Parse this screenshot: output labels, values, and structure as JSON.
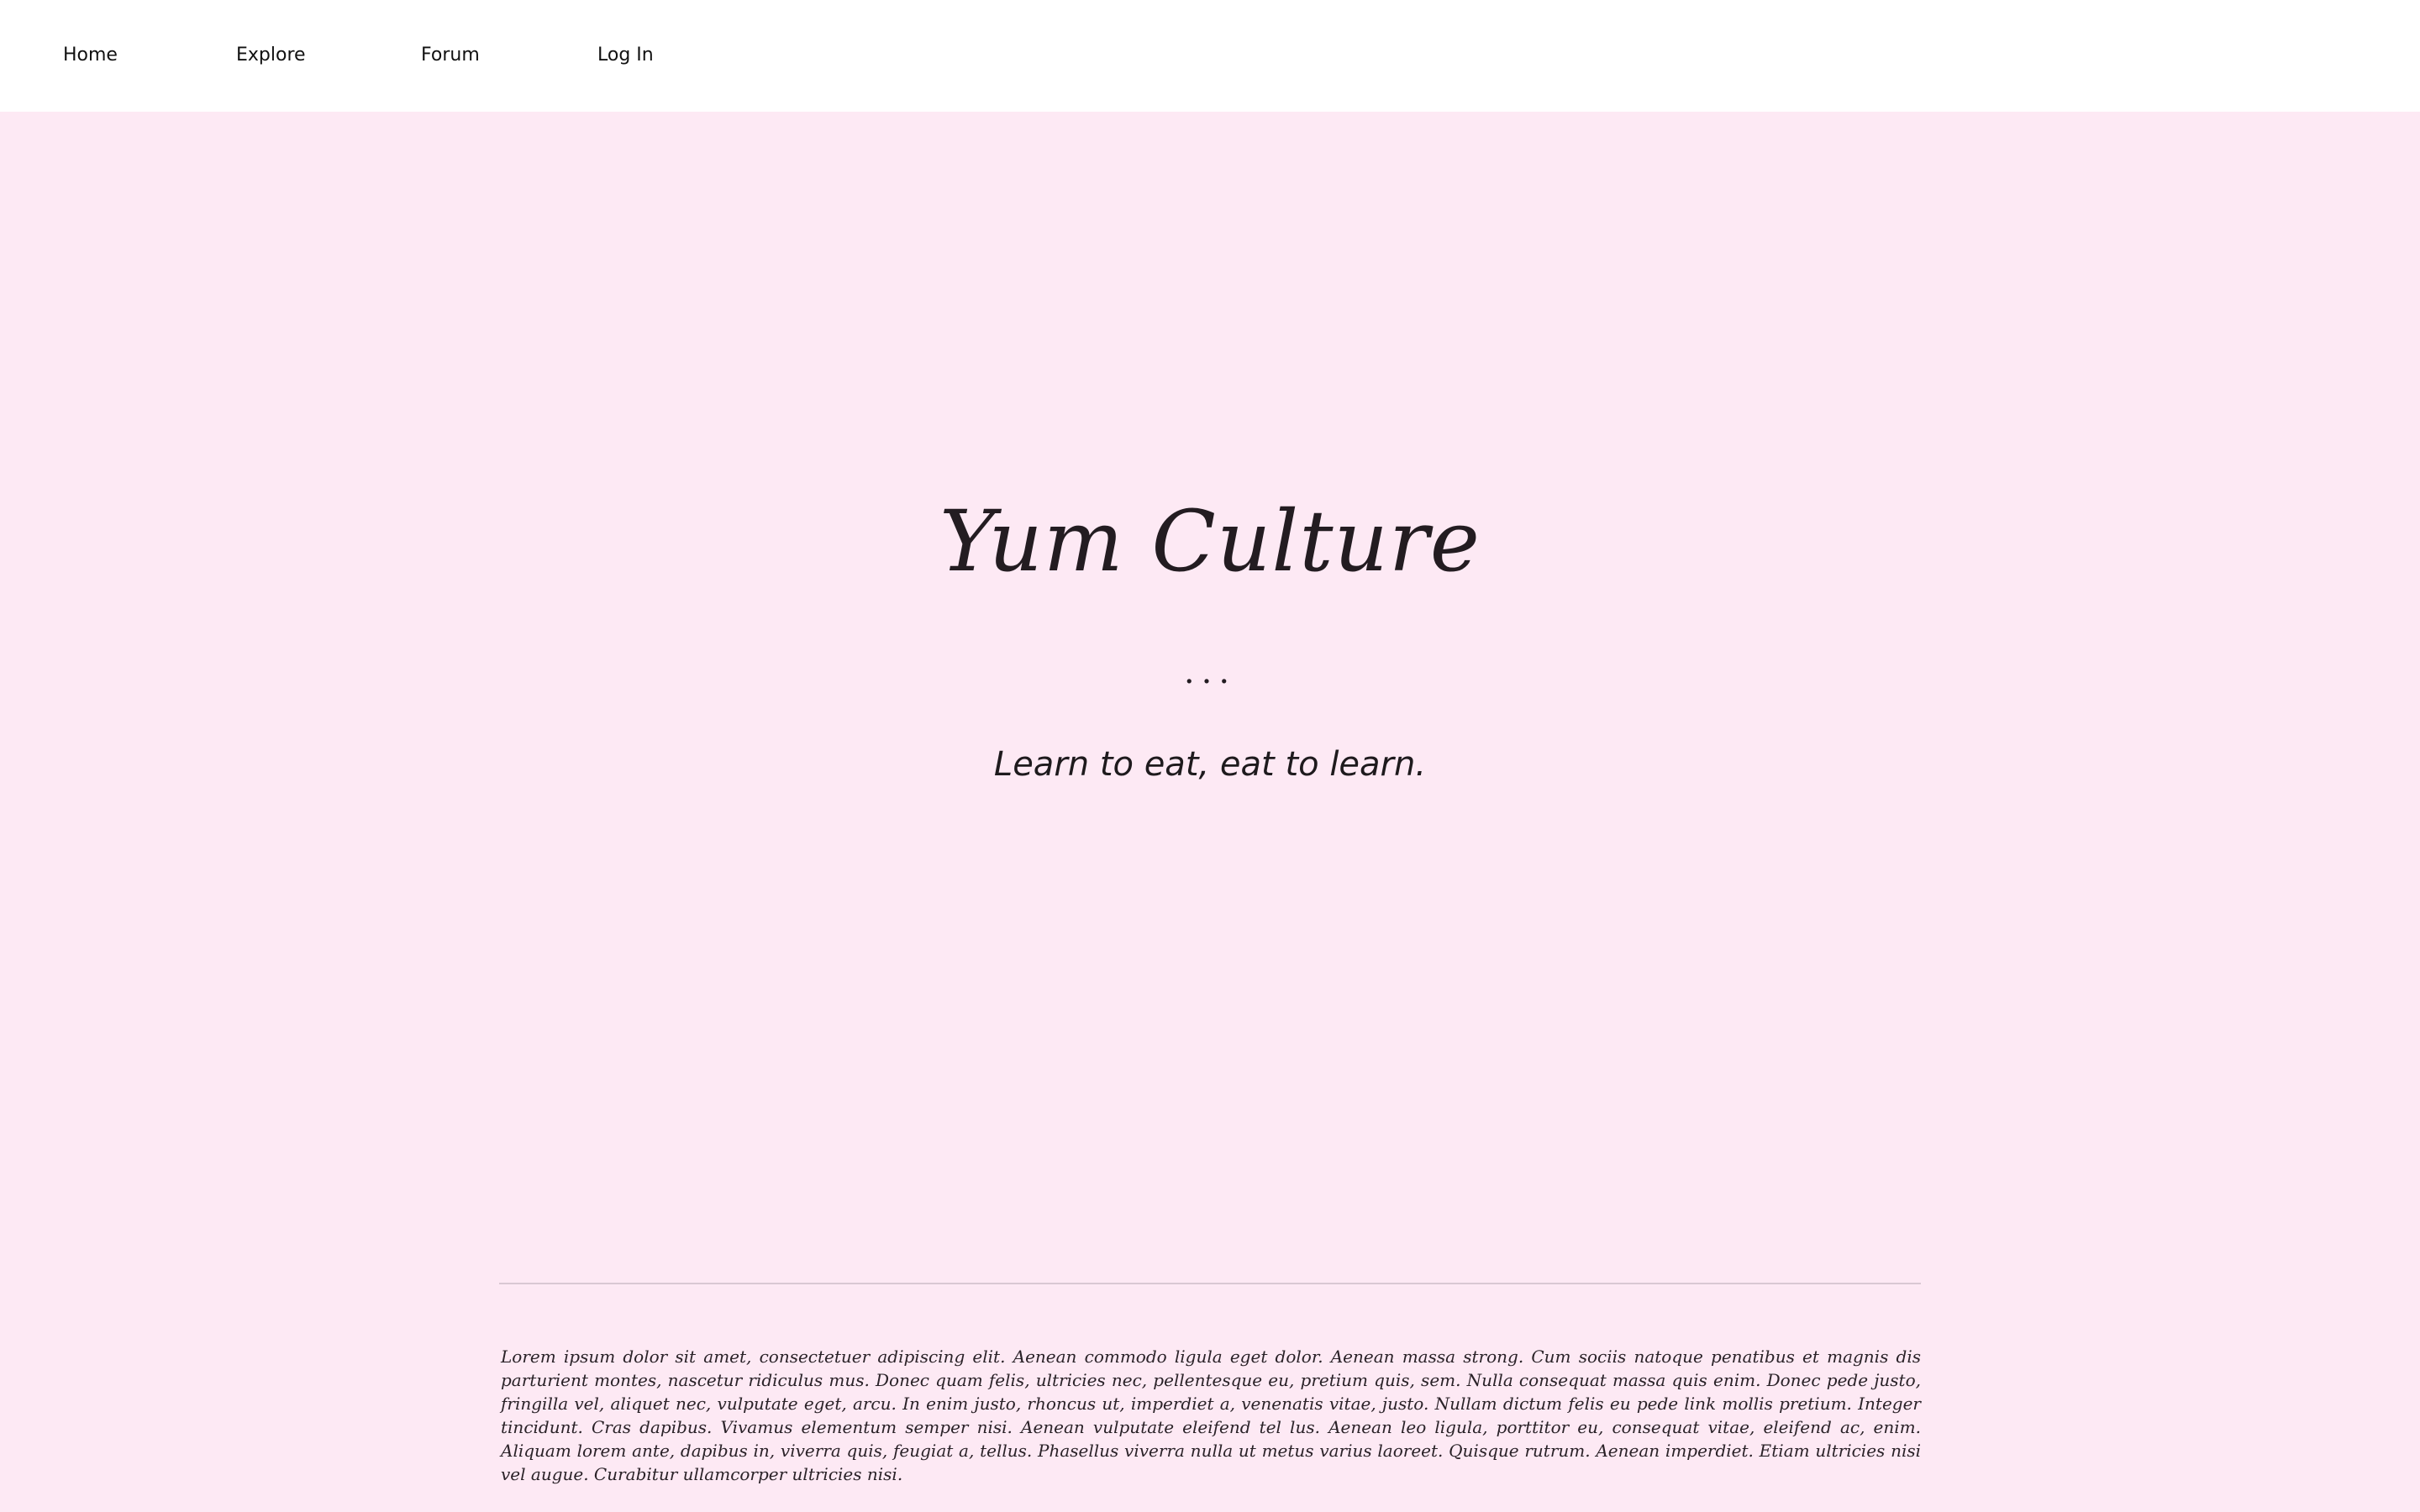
{
  "nav": {
    "items": [
      {
        "label": "Home"
      },
      {
        "label": "Explore"
      },
      {
        "label": "Forum"
      },
      {
        "label": "Log In"
      }
    ]
  },
  "hero": {
    "title": "Yum Culture",
    "dots": "...",
    "tagline": "Learn to eat, eat to learn."
  },
  "footer": {
    "body_text": "Lorem ipsum dolor sit amet, consectetuer adipiscing elit. Aenean commodo ligula eget dolor. Aenean massa strong. Cum sociis natoque penatibus et magnis dis parturient montes, nascetur ridiculus mus. Donec quam felis, ultricies nec, pellentesque eu, pretium quis, sem. Nulla consequat massa quis enim. Donec pede justo, fringilla vel, aliquet nec, vulputate eget, arcu. In enim justo, rhoncus ut, imperdiet a, venenatis vitae, justo. Nullam dictum felis eu pede link mollis pretium. Integer tincidunt. Cras dapibus. Vivamus elementum semper nisi. Aenean vulputate eleifend tel lus. Aenean leo ligula, porttitor eu, consequat vitae, eleifend ac, enim. Aliquam lorem ante, dapibus in, viverra quis, feugiat a, tellus. Phasellus viverra nulla ut metus varius laoreet. Quisque rutrum. Aenean imperdiet. Etiam ultricies nisi vel augue. Curabitur ullamcorper ultricies nisi."
  },
  "colors": {
    "page_background": "#fde9f4",
    "nav_background": "#ffffff",
    "text": "#1e1a1d",
    "divider": "#d9c8d3"
  }
}
